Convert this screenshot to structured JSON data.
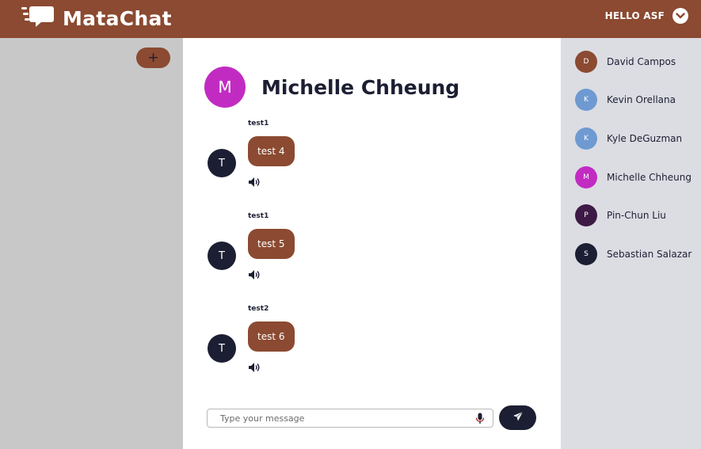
{
  "app": {
    "name": "MataChat",
    "logo_icon": "chat-bubbles-icon"
  },
  "header": {
    "greeting": "HELLO ASF",
    "menu_icon": "chevron-down-icon"
  },
  "sidebar": {
    "add_label": "+"
  },
  "chat": {
    "contact_name": "Michelle Chheung",
    "contact_initial": "M",
    "messages": [
      {
        "sender": "test1",
        "initial": "T",
        "text": "test 4"
      },
      {
        "sender": "test1",
        "initial": "T",
        "text": "test 5"
      },
      {
        "sender": "test2",
        "initial": "T",
        "text": "test 6"
      }
    ],
    "composer": {
      "placeholder": "Type your message",
      "value": ""
    }
  },
  "contacts": [
    {
      "initial": "D",
      "name": "David Campos",
      "color": "#8b4a31"
    },
    {
      "initial": "K",
      "name": "Kevin Orellana",
      "color": "#6e9ad1"
    },
    {
      "initial": "K",
      "name": "Kyle DeGuzman",
      "color": "#6e9ad1"
    },
    {
      "initial": "M",
      "name": "Michelle Chheung",
      "color": "#c22bc2"
    },
    {
      "initial": "P",
      "name": "Pin-Chun Liu",
      "color": "#3d1a45"
    },
    {
      "initial": "S",
      "name": "Sebastian Salazar",
      "color": "#1c1f33"
    }
  ],
  "colors": {
    "brand": "#8b4a31",
    "dark": "#1c1f33",
    "sidebar_bg": "#c8c8c8",
    "contacts_bg": "#dcdce3"
  }
}
